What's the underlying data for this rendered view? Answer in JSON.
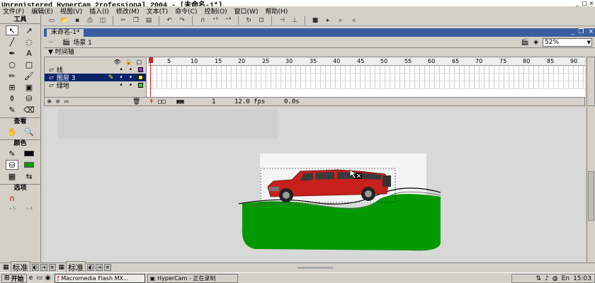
{
  "window": {
    "title": "Unregistered HyperCam 2rofessional 2004 - [未命名-1*]",
    "controls": [
      "_",
      "□",
      "×"
    ]
  },
  "menu": [
    "文件(F)",
    "编辑(E)",
    "视图(V)",
    "插入(I)",
    "修改(M)",
    "文本(T)",
    "命令(C)",
    "控制(O)",
    "窗口(W)",
    "帮助(H)"
  ],
  "tools": {
    "title": "工具",
    "view_title": "查看",
    "colors_title": "颜色",
    "options_title": "选项"
  },
  "document": {
    "tab_label": "未命名-1*",
    "scene_label": "场景 1",
    "zoom": "52%"
  },
  "timeline": {
    "header": "▼ 时间轴",
    "ruler": [
      "1",
      "5",
      "10",
      "15",
      "20",
      "25",
      "30",
      "35",
      "40",
      "45",
      "50",
      "55",
      "60",
      "65",
      "70",
      "75",
      "80",
      "85",
      "90"
    ],
    "layers": [
      {
        "name": "线",
        "color": "#9933cc",
        "selected": false
      },
      {
        "name": "图层 3",
        "color": "#ffff00",
        "selected": true
      },
      {
        "name": "绿地",
        "color": "#33cc33",
        "selected": false
      }
    ],
    "current_frame": "1",
    "fps": "12.0 fps",
    "elapsed": "0.0s"
  },
  "propbar": {
    "panel1": "标准",
    "panel2": "标准"
  },
  "taskbar": {
    "start": "开始",
    "tasks": [
      "Macromedia Flash MX...",
      "HyperCam - 正在录制"
    ],
    "clock": "15:03"
  },
  "colors": {
    "green": "#009900",
    "car_red": "#c8201c"
  }
}
